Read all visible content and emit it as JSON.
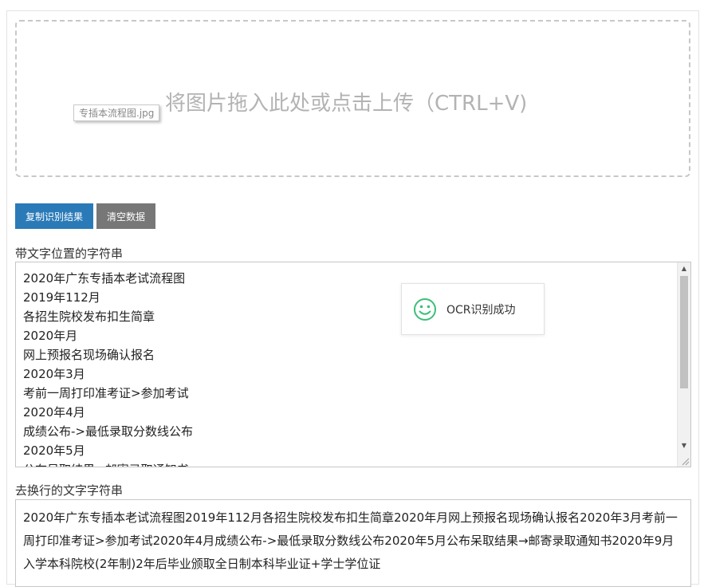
{
  "upload": {
    "prompt": "将图片拖入此处或点击上传（CTRL+V)",
    "file_name": "专插本流程图.jpg"
  },
  "buttons": {
    "copy": "复制识别结果",
    "clear": "清空数据"
  },
  "section_positions": {
    "label": "带文字位置的字符串",
    "lines": [
      "2020年广东专插本老试流程图",
      "2019年112月",
      "各招生院校发布扣生简章",
      "2020年月",
      "网上预报名现场确认报名",
      "2020年3月",
      "考前一周打印准考证>参加考试",
      "2020年4月",
      "成绩公布->最低录取分数线公布",
      "2020年5月",
      "公布呆取结果→邮寄录取通知书"
    ]
  },
  "section_flat": {
    "label": "去换行的文字字符串",
    "text": "2020年广东专插本老试流程图2019年112月各招生院校发布扣生简章2020年月网上预报名现场确认报名2020年3月考前一周打印准考证>参加考试2020年4月成绩公布->最低录取分数线公布2020年5月公布呆取结果→邮寄录取通知书2020年9月入学本科院校(2年制)2年后毕业颁取全日制本科毕业证+学士学位证"
  },
  "toast": {
    "message": "OCR识别成功",
    "icon": "smiley-icon",
    "color": "#3cbf7a"
  },
  "colors": {
    "primary_button": "#2a7ab8",
    "secondary_button": "#777777"
  }
}
